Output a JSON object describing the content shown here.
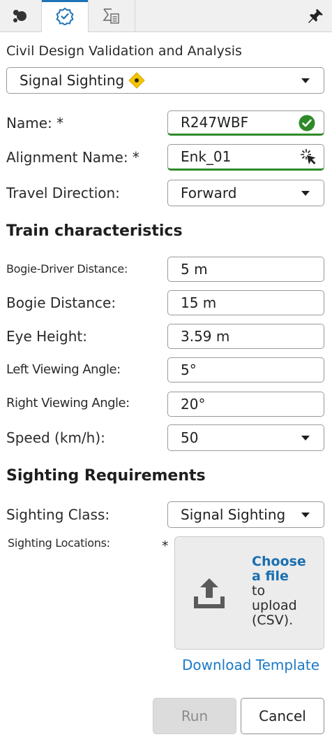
{
  "tabs": [
    {
      "icon": "bubbles-icon",
      "active": false
    },
    {
      "icon": "check-badge-icon",
      "active": true
    },
    {
      "icon": "clipboard-sigma-icon",
      "active": false
    }
  ],
  "section_title": "Civil Design Validation and Analysis",
  "analysis_type": {
    "value": "Signal Sighting",
    "badge_icon": "warning-diamond-icon"
  },
  "form": {
    "name": {
      "label": "Name: *",
      "value": "R247WBF",
      "status_icon": "check-circle-icon"
    },
    "alignment": {
      "label": "Alignment Name: *",
      "value": "Enk_01",
      "picker_icon": "pick-cursor-icon"
    },
    "travel_direction": {
      "label": "Travel Direction:",
      "value": "Forward"
    }
  },
  "train": {
    "heading": "Train characteristics",
    "bogie_driver": {
      "label": "Bogie-Driver Distance:",
      "value": "5 m"
    },
    "bogie_distance": {
      "label": "Bogie Distance:",
      "value": "15 m"
    },
    "eye_height": {
      "label": "Eye Height:",
      "value": "3.59 m"
    },
    "left_angle": {
      "label": "Left Viewing Angle:",
      "value": "5°"
    },
    "right_angle": {
      "label": "Right Viewing Angle:",
      "value": "20°"
    },
    "speed": {
      "label": "Speed (km/h):",
      "value": "50"
    }
  },
  "sighting": {
    "heading": "Sighting Requirements",
    "class": {
      "label": "Sighting Class:",
      "value": "Signal Sighting"
    },
    "locations": {
      "label": "Sighting Locations:",
      "required_mark": "*",
      "choose_line1": "Choose",
      "choose_line2": "a file",
      "upload_line1": "to",
      "upload_line2": "upload",
      "upload_line3": "(CSV)."
    },
    "download_template": "Download Template"
  },
  "actions": {
    "run": "Run",
    "cancel": "Cancel"
  },
  "colors": {
    "accent": "#1f73b7",
    "valid": "#2e8a28",
    "warning": "#f5c400",
    "link": "#1d7ac6"
  }
}
